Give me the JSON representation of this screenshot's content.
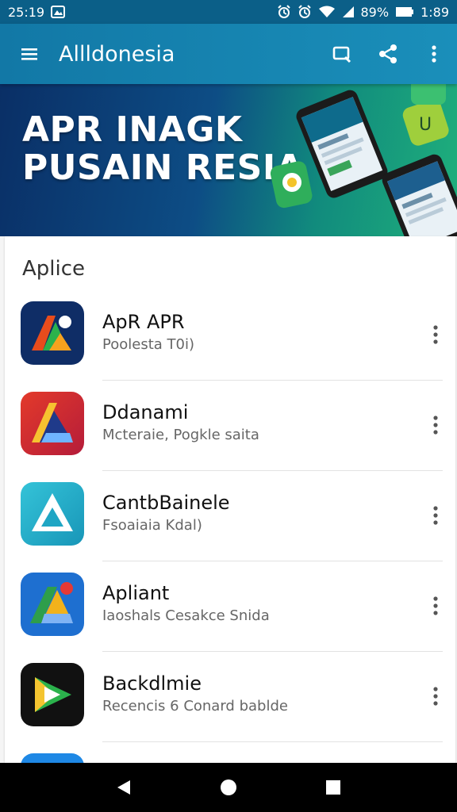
{
  "status_bar": {
    "time": "25:19",
    "battery": "89%",
    "clock": "1:89"
  },
  "app_bar": {
    "title": "Allldonesia",
    "menu_icon": "hamburger-menu-icon",
    "action_icons": [
      "cast-icon",
      "share-icon",
      "more-vert-icon"
    ]
  },
  "banner": {
    "line1": "APR INAGK",
    "line2": "PUSAIN RESIA"
  },
  "section": {
    "title": "Aplice"
  },
  "apps": [
    {
      "name": "ApR APR",
      "subtitle": "Poolesta T0i)",
      "icon": "arrow-a-icon",
      "colors": [
        "#0f2d66",
        "#e84c1c",
        "#2bb24c"
      ]
    },
    {
      "name": "Ddanami",
      "subtitle": "Mcteraie, Pogkle saita",
      "icon": "a-logo-icon",
      "colors": [
        "#d8272f",
        "#1f3a8a",
        "#f6c230"
      ]
    },
    {
      "name": "CantbBainele",
      "subtitle": "Fsoaiaia Kdal)",
      "icon": "triangle-a-icon",
      "colors": [
        "#1fa6c4",
        "#2bc0cf",
        "#ffffff"
      ]
    },
    {
      "name": "Apliant",
      "subtitle": "Iaoshals Cesakce Snida",
      "icon": "drive-a-icon",
      "colors": [
        "#1e6fd0",
        "#2e9e4b",
        "#f2b21b"
      ]
    },
    {
      "name": "Backdlmie",
      "subtitle": "Recencis 6 Conard bablde",
      "icon": "play-icon",
      "colors": [
        "#111111",
        "#2bb24c",
        "#f4c430"
      ]
    }
  ],
  "nav": {
    "icons": [
      "back-icon",
      "home-icon",
      "recents-icon"
    ]
  }
}
